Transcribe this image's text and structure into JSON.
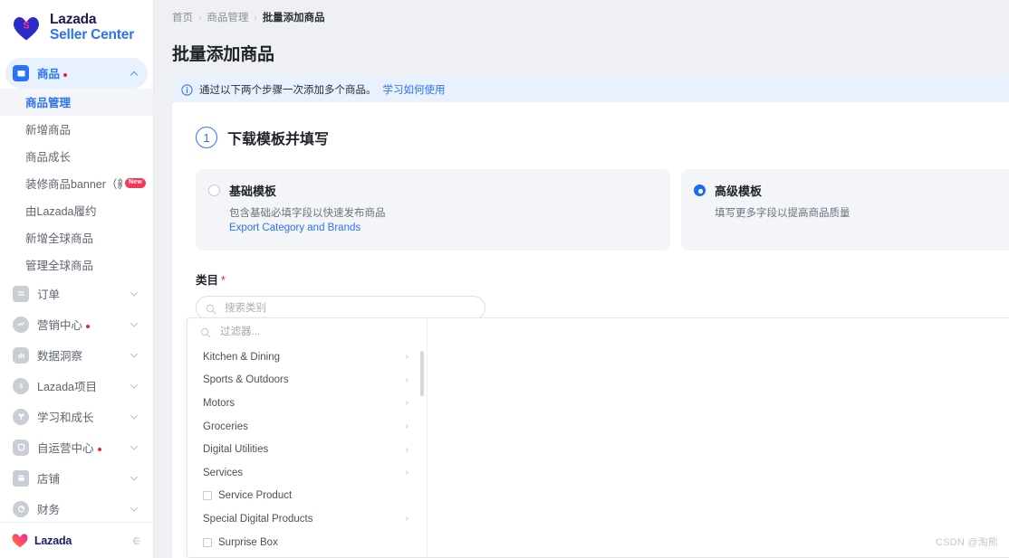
{
  "brand": {
    "line1": "Lazada",
    "line2": "Seller Center",
    "logo_icon": "lazada-heart-icon",
    "accent": "#2a73f5",
    "heart_color": "#2b2bc9",
    "s_color": "#ff2e8b"
  },
  "sidebar": {
    "groups": [
      {
        "label": "商品",
        "icon": "bag-icon",
        "active": true,
        "has_dot": true,
        "chevron": "chevron-up-icon",
        "children": [
          {
            "label": "商品管理",
            "current": true
          },
          {
            "label": "新增商品",
            "current": false
          },
          {
            "label": "商品成长",
            "current": false
          },
          {
            "label": "装修商品banner（新版…",
            "current": false,
            "badge": "New"
          },
          {
            "label": "由Lazada履约",
            "current": false
          },
          {
            "label": "新增全球商品",
            "current": false
          },
          {
            "label": "管理全球商品",
            "current": false
          }
        ]
      },
      {
        "label": "订单",
        "icon": "orders-icon",
        "active": false,
        "has_dot": false,
        "chevron": "chevron-down-icon",
        "children": []
      },
      {
        "label": "营销中心",
        "icon": "marketing-icon",
        "active": false,
        "has_dot": true,
        "chevron": "chevron-down-icon",
        "children": []
      },
      {
        "label": "数据洞察",
        "icon": "analytics-icon",
        "active": false,
        "has_dot": false,
        "chevron": "chevron-down-icon",
        "children": []
      },
      {
        "label": "Lazada项目",
        "icon": "dollar-icon",
        "active": false,
        "has_dot": false,
        "chevron": "chevron-down-icon",
        "children": []
      },
      {
        "label": "学习和成长",
        "icon": "growth-icon",
        "active": false,
        "has_dot": false,
        "chevron": "chevron-down-icon",
        "children": []
      },
      {
        "label": "自运营中心",
        "icon": "shield-icon",
        "active": false,
        "has_dot": true,
        "chevron": "chevron-down-icon",
        "children": []
      },
      {
        "label": "店铺",
        "icon": "store-icon",
        "active": false,
        "has_dot": false,
        "chevron": "chevron-down-icon",
        "children": []
      },
      {
        "label": "财务",
        "icon": "finance-icon",
        "active": false,
        "has_dot": false,
        "chevron": "chevron-down-icon",
        "children": []
      }
    ],
    "footer": {
      "logo_icon": "lazada-heart-icon",
      "name": "Lazada",
      "collapse_icon": "collapse-sidebar-icon"
    }
  },
  "breadcrumb": {
    "items": [
      "首页",
      "商品管理",
      "批量添加商品"
    ],
    "separator": "›"
  },
  "page": {
    "title": "批量添加商品"
  },
  "notice": {
    "icon": "info-circle-icon",
    "text": "通过以下两个步骤一次添加多个商品。",
    "link": "学习如何使用"
  },
  "step": {
    "number": "1",
    "title": "下载模板并填写"
  },
  "templates": [
    {
      "title": "基础模板",
      "desc": "包含基础必填字段以快速发布商品",
      "link": "Export Category and Brands",
      "selected": false
    },
    {
      "title": "高级模板",
      "desc": "填写更多字段以提高商品质量",
      "link": "",
      "selected": true
    }
  ],
  "category": {
    "label": "类目",
    "required_mark": "*",
    "search_placeholder": "搜索类别",
    "search_value": "",
    "search_icon": "search-icon",
    "dropdown": {
      "filter_placeholder": "过滤器...",
      "filter_value": "",
      "filter_icon": "search-icon",
      "items": [
        {
          "name": "Kitchen & Dining",
          "type": "expandable"
        },
        {
          "name": "Sports & Outdoors",
          "type": "expandable"
        },
        {
          "name": "Motors",
          "type": "expandable"
        },
        {
          "name": "Groceries",
          "type": "expandable"
        },
        {
          "name": "Digital Utilities",
          "type": "expandable"
        },
        {
          "name": "Services",
          "type": "expandable"
        },
        {
          "name": "Service Product",
          "type": "checkbox"
        },
        {
          "name": "Special Digital Products",
          "type": "expandable"
        },
        {
          "name": "Surprise Box",
          "type": "checkbox"
        }
      ]
    }
  },
  "watermark": "CSDN @淘熊"
}
